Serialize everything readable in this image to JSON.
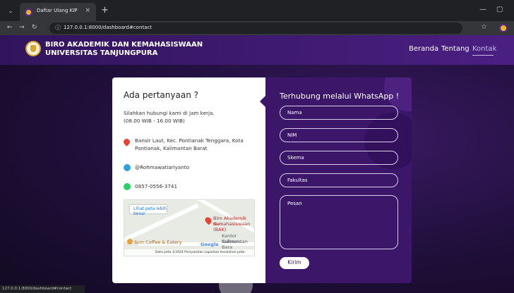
{
  "browser": {
    "tab_title": "Daftar Ulang KIP",
    "url": "127.0.0.1:8000/dashboard#contact",
    "status_url": "127.0.0.1:8000/dashboard#contact"
  },
  "header": {
    "brand_line1": "BIRO AKADEMIK DAN KEMAHASISWAAN",
    "brand_line2": "UNIVERSITAS TANJUNGPURA",
    "nav": [
      "Beranda",
      "Tentang",
      "Kontak"
    ],
    "active_nav": "Kontak"
  },
  "contact": {
    "title": "Ada pertanyaan ?",
    "hours_line1": "Silahkan hubungi kami di jam kerja.",
    "hours_line2": "(08.00 WIB - 16.00 WIB)",
    "address_line1": "Bansir Laut, Kec. Pontianak Tenggara, Kota",
    "address_line2": "Pontianak, Kalimantan Barat",
    "telegram": "@Rohmawatiariyanto",
    "whatsapp": "0857-0556-3741",
    "map": {
      "button": "Lihat peta lebih besar",
      "place_line1": "Biro Akademik dan",
      "place_line2": "Kemahasiswaan (BAK)",
      "poi1_line1": "Kantor Gubernu",
      "poi1_line2": "Kalimantan Bara",
      "poi2": "Scm Coffee & Eatery",
      "google": "Google",
      "footer": "Data peta ©2024   Persyaratan   Laporkan kesalahan peta"
    }
  },
  "form": {
    "title": "Terhubung melalui WhatsApp !",
    "fields": {
      "nama": "Nama",
      "nim": "NIM",
      "skema": "Skema",
      "fakultas": "Fakultas",
      "pesan": "Pesan"
    },
    "submit": "Kirim"
  },
  "colors": {
    "brand_purple": "#3b1669",
    "header_purple": "#4a1f82",
    "accent_lavender": "#c9b6f2"
  }
}
